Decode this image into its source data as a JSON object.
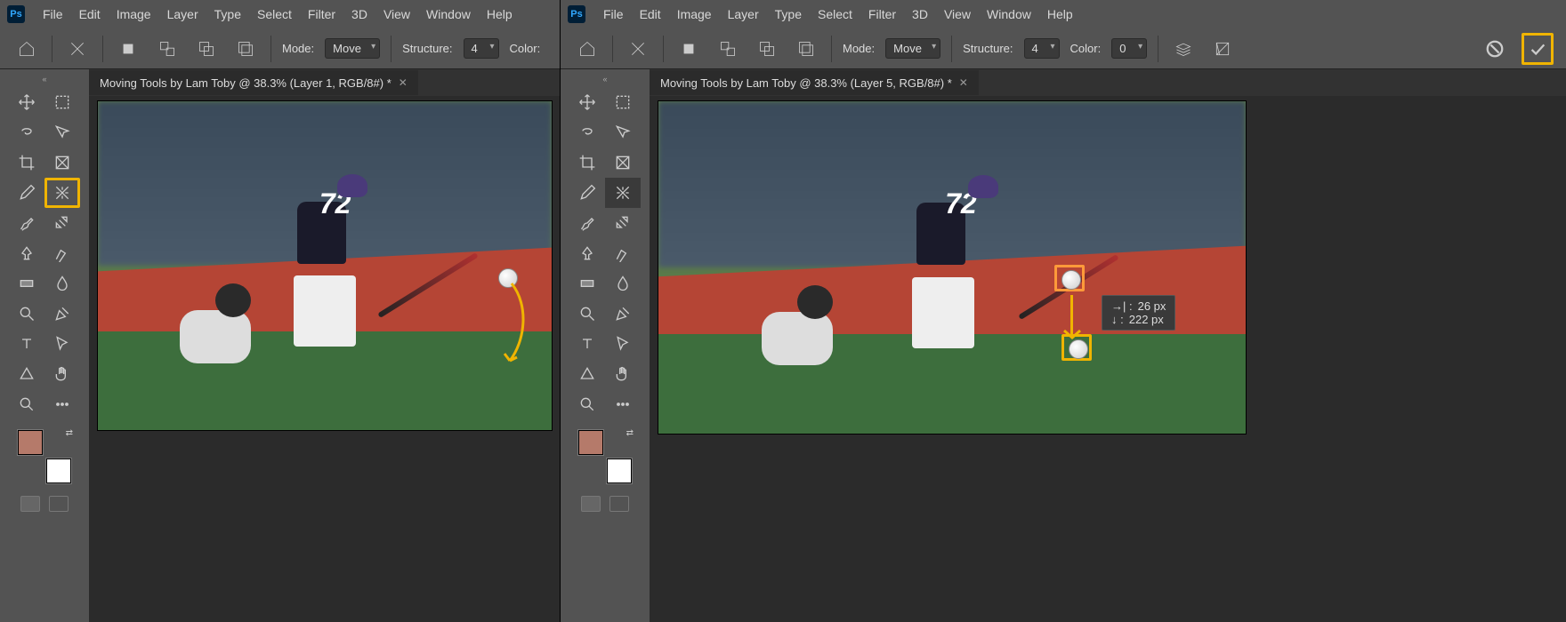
{
  "app": {
    "logo": "Ps"
  },
  "menu": {
    "items": [
      "File",
      "Edit",
      "Image",
      "Layer",
      "Type",
      "Select",
      "Filter",
      "3D",
      "View",
      "Window",
      "Help"
    ]
  },
  "options": {
    "mode_label": "Mode:",
    "mode_value": "Move",
    "structure_label": "Structure:",
    "structure_value": "4",
    "color_label": "Color:",
    "color_value": "0"
  },
  "documents": {
    "left": {
      "title": "Moving Tools by Lam Toby @ 38.3% (Layer 1, RGB/8#) *"
    },
    "right": {
      "title": "Moving Tools by Lam Toby @ 38.3% (Layer 5, RGB/8#) *"
    }
  },
  "measure": {
    "dx_label": "→| :",
    "dx_value": "26 px",
    "dy_label": "↓ :",
    "dy_value": "222 px"
  },
  "tools": [
    "move",
    "rect-marquee",
    "lasso",
    "quick-select",
    "crop",
    "frame",
    "eyedropper",
    "content-aware-move",
    "brush",
    "healing",
    "clone",
    "blur",
    "gradient",
    "dodge",
    "zoom",
    "pen",
    "type",
    "path-select",
    "shape",
    "hand",
    "magnify",
    "more"
  ],
  "colors": {
    "foreground": "#b57a6a",
    "background": "#ffffff"
  },
  "jersey_number": "72"
}
